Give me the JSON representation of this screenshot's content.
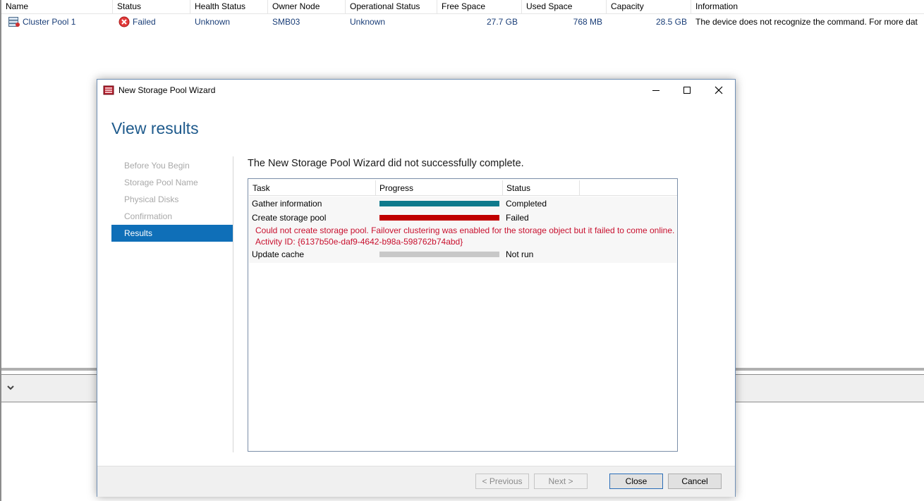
{
  "list": {
    "columns": [
      "Name",
      "Status",
      "Health Status",
      "Owner Node",
      "Operational Status",
      "Free Space",
      "Used Space",
      "Capacity",
      "Information"
    ],
    "row": {
      "name": "Cluster Pool 1",
      "status": "Failed",
      "health_status": "Unknown",
      "owner_node": "SMB03",
      "operational_status": "Unknown",
      "free_space": "27.7 GB",
      "used_space": "768 MB",
      "capacity": "28.5 GB",
      "information": "The device does not recognize the command. For more dat"
    }
  },
  "dialog": {
    "title": "New Storage Pool Wizard",
    "page_title": "View results",
    "nav": [
      "Before You Begin",
      "Storage Pool Name",
      "Physical Disks",
      "Confirmation",
      "Results"
    ],
    "active_nav": "Results",
    "result_heading": "The New Storage Pool Wizard did not successfully complete.",
    "table_headers": [
      "Task",
      "Progress",
      "Status"
    ],
    "tasks": [
      {
        "task": "Gather information",
        "status": "Completed",
        "progress": 1.0,
        "bar_color": "#0e7a8c"
      },
      {
        "task": "Create storage pool",
        "status": "Failed",
        "progress": 1.0,
        "bar_color": "#c00000"
      },
      {
        "task": "Update cache",
        "status": "Not run",
        "progress": 1.0,
        "bar_color": "#c8c8c8"
      }
    ],
    "error_line1": "Could not create storage pool. Failover clustering was enabled for the storage object but it failed to come online.",
    "error_line2": "Activity ID: {6137b50e-daf9-4642-b98a-598762b74abd}",
    "buttons": {
      "previous": "< Previous",
      "next": "Next >",
      "close": "Close",
      "cancel": "Cancel"
    }
  },
  "colors": {
    "accent": "#0f6fb8",
    "title_blue": "#1e5a8c",
    "error": "#c8102e"
  }
}
